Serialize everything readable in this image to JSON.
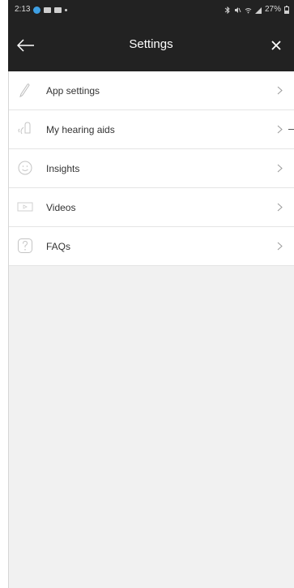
{
  "status_bar": {
    "time": "2:13",
    "battery": "27%"
  },
  "header": {
    "title": "Settings"
  },
  "menu": {
    "items": [
      {
        "label": "App settings",
        "icon": "pencil-icon"
      },
      {
        "label": "My hearing aids",
        "icon": "hearing-aid-icon"
      },
      {
        "label": "Insights",
        "icon": "smiley-icon"
      },
      {
        "label": "Videos",
        "icon": "video-icon"
      },
      {
        "label": "FAQs",
        "icon": "question-icon"
      }
    ]
  },
  "colors": {
    "header_bg": "#222222",
    "content_bg": "#f1f1f1",
    "accent": "#3ea0e4"
  }
}
